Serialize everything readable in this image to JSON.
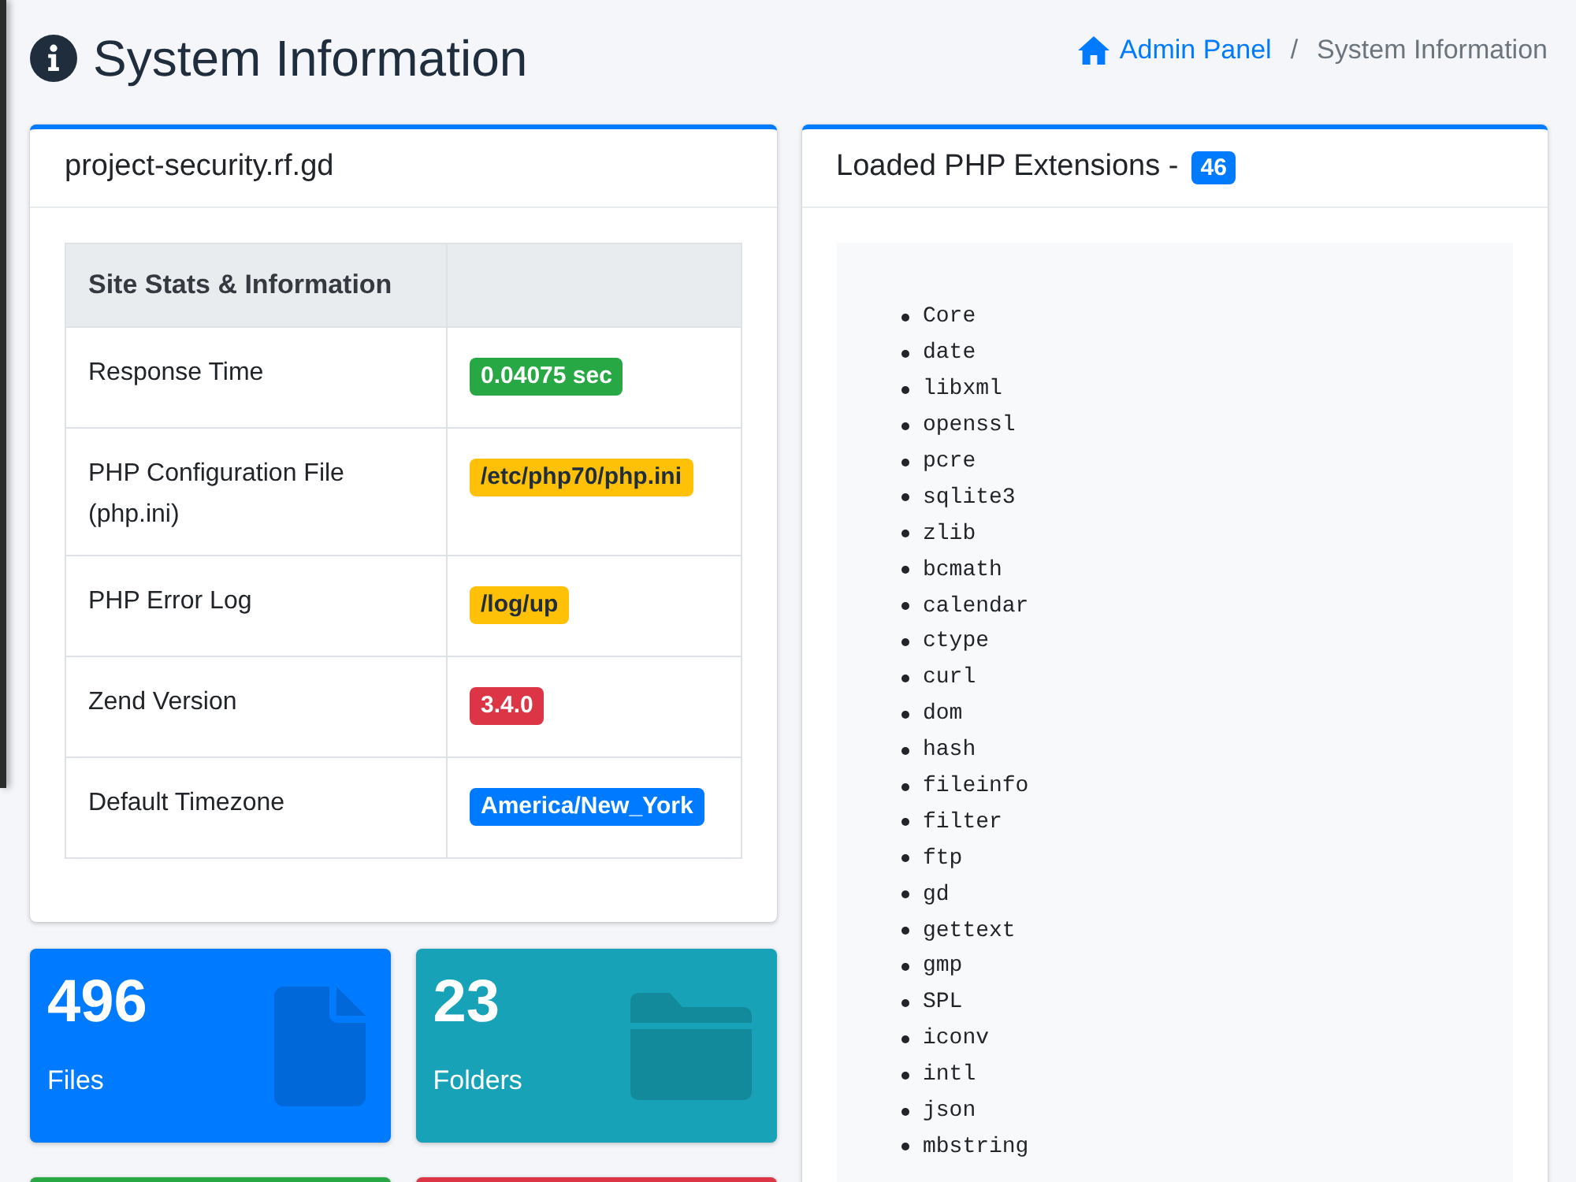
{
  "header": {
    "title": "System Information",
    "breadcrumb": {
      "separator": "/",
      "items": [
        {
          "label": "Admin Panel",
          "kind": "home"
        },
        {
          "label": "System Information",
          "kind": "current"
        }
      ]
    }
  },
  "site_card": {
    "title": "project-security.rf.gd",
    "table": {
      "columns": [
        "Site Stats & Information"
      ],
      "rows": [
        {
          "label": "Response Time",
          "value": "0.04075 sec",
          "color": "#28a745"
        },
        {
          "label": "PHP Configuration File (php.ini)",
          "value": "/etc/php70/php.ini",
          "color": "#ffc107"
        },
        {
          "label": "PHP Error Log",
          "value": "/log/up",
          "color": "#ffc107"
        },
        {
          "label": "Zend Version",
          "value": "3.4.0",
          "color": "#dc3545"
        },
        {
          "label": "Default Timezone",
          "value": "America/New_York",
          "color": "#007bff"
        }
      ]
    }
  },
  "stats": [
    {
      "value": "496",
      "label": "Files",
      "kind": "files",
      "color": "#007bff"
    },
    {
      "value": "23",
      "label": "Folders",
      "kind": "folders",
      "color": "#17a2b8"
    },
    {
      "color": "#28a745"
    },
    {
      "color": "#dc3545"
    }
  ],
  "extensions_card": {
    "title": "Loaded PHP Extensions -",
    "count": "46",
    "items": [
      "Core",
      "date",
      "libxml",
      "openssl",
      "pcre",
      "sqlite3",
      "zlib",
      "bcmath",
      "calendar",
      "ctype",
      "curl",
      "dom",
      "hash",
      "fileinfo",
      "filter",
      "ftp",
      "gd",
      "gettext",
      "gmp",
      "SPL",
      "iconv",
      "intl",
      "json",
      "mbstring"
    ]
  }
}
